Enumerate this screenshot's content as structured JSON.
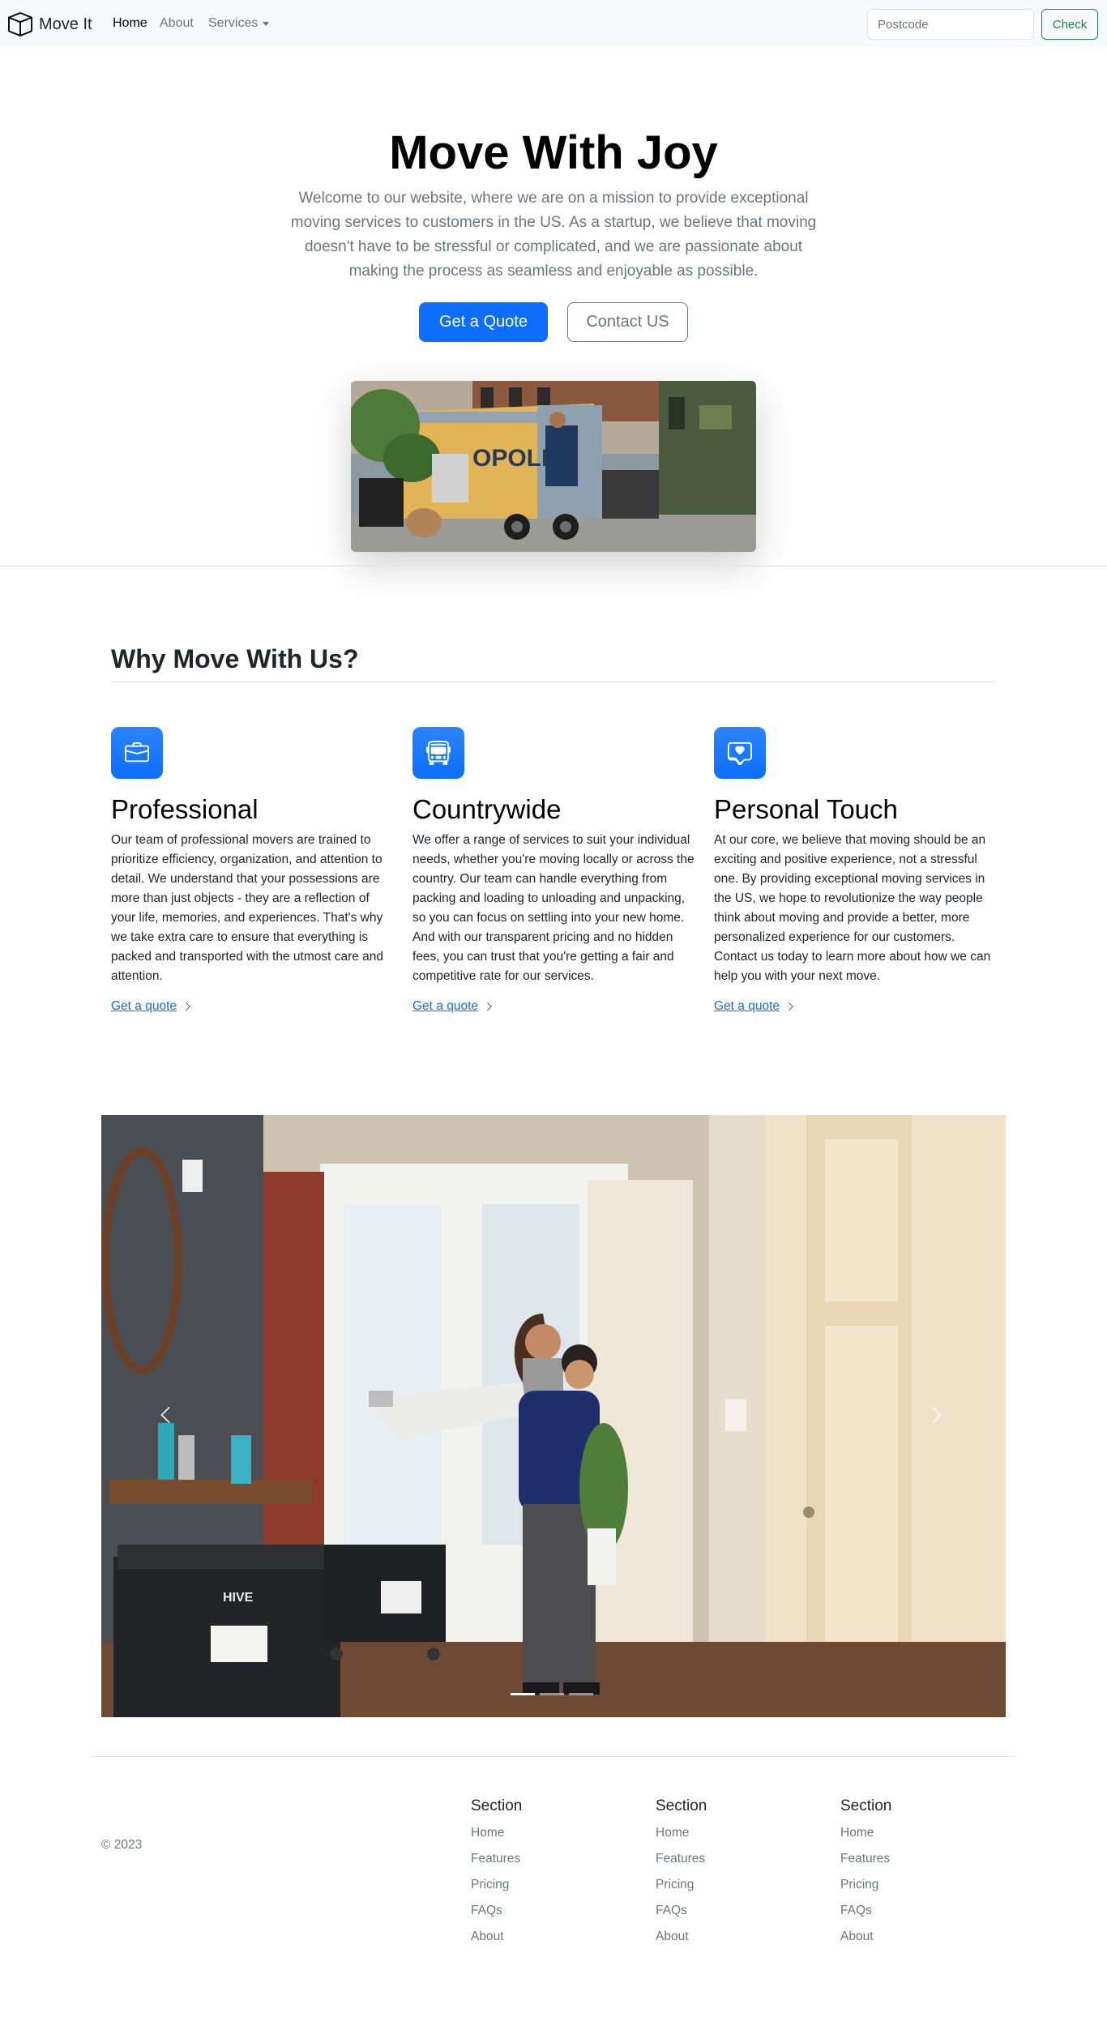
{
  "navbar": {
    "brand": "Move It",
    "links": [
      "Home",
      "About",
      "Services"
    ],
    "postcode_placeholder": "Postcode",
    "check_label": "Check"
  },
  "hero": {
    "title": "Move With Joy",
    "lead": "Welcome to our website, where we are on a mission to provide exceptional moving services to customers in the US. As a startup, we believe that moving doesn't have to be stressful or complicated, and we are passionate about making the process as seamless and enjoyable as possible.",
    "primary_button": "Get a Quote",
    "secondary_button": "Contact US"
  },
  "features": {
    "title": "Why Move With Us?",
    "items": [
      {
        "icon": "briefcase-icon",
        "title": "Professional",
        "text": "Our team of professional movers are trained to prioritize efficiency, organization, and attention to detail. We understand that your possessions are more than just objects - they are a reflection of your life, memories, and experiences. That's why we take extra care to ensure that everything is packed and transported with the utmost care and attention.",
        "link": "Get a quote"
      },
      {
        "icon": "bus-icon",
        "title": "Countrywide",
        "text": "We offer a range of services to suit your individual needs, whether you're moving locally or across the country. Our team can handle everything from packing and loading to unloading and unpacking, so you can focus on settling into your new home. And with our transparent pricing and no hidden fees, you can trust that you're getting a fair and competitive rate for our services.",
        "link": "Get a quote"
      },
      {
        "icon": "chat-heart-icon",
        "title": "Personal Touch",
        "text": "At our core, we believe that moving should be an exciting and positive experience, not a stressful one. By providing exceptional moving services in the US, we hope to revolutionize the way people think about moving and provide a better, more personalized experience for our customers. Contact us today to learn more about how we can help you with your next move.",
        "link": "Get a quote"
      }
    ]
  },
  "carousel": {
    "active_index": 0,
    "slide_count": 3
  },
  "footer": {
    "copyright": "© 2023",
    "columns": [
      {
        "title": "Section",
        "links": [
          "Home",
          "Features",
          "Pricing",
          "FAQs",
          "About"
        ]
      },
      {
        "title": "Section",
        "links": [
          "Home",
          "Features",
          "Pricing",
          "FAQs",
          "About"
        ]
      },
      {
        "title": "Section",
        "links": [
          "Home",
          "Features",
          "Pricing",
          "FAQs",
          "About"
        ]
      }
    ]
  },
  "colors": {
    "primary": "#0d6efd",
    "success": "#198754",
    "muted": "#6c757d",
    "navbar_bg": "#f8f9fa"
  }
}
